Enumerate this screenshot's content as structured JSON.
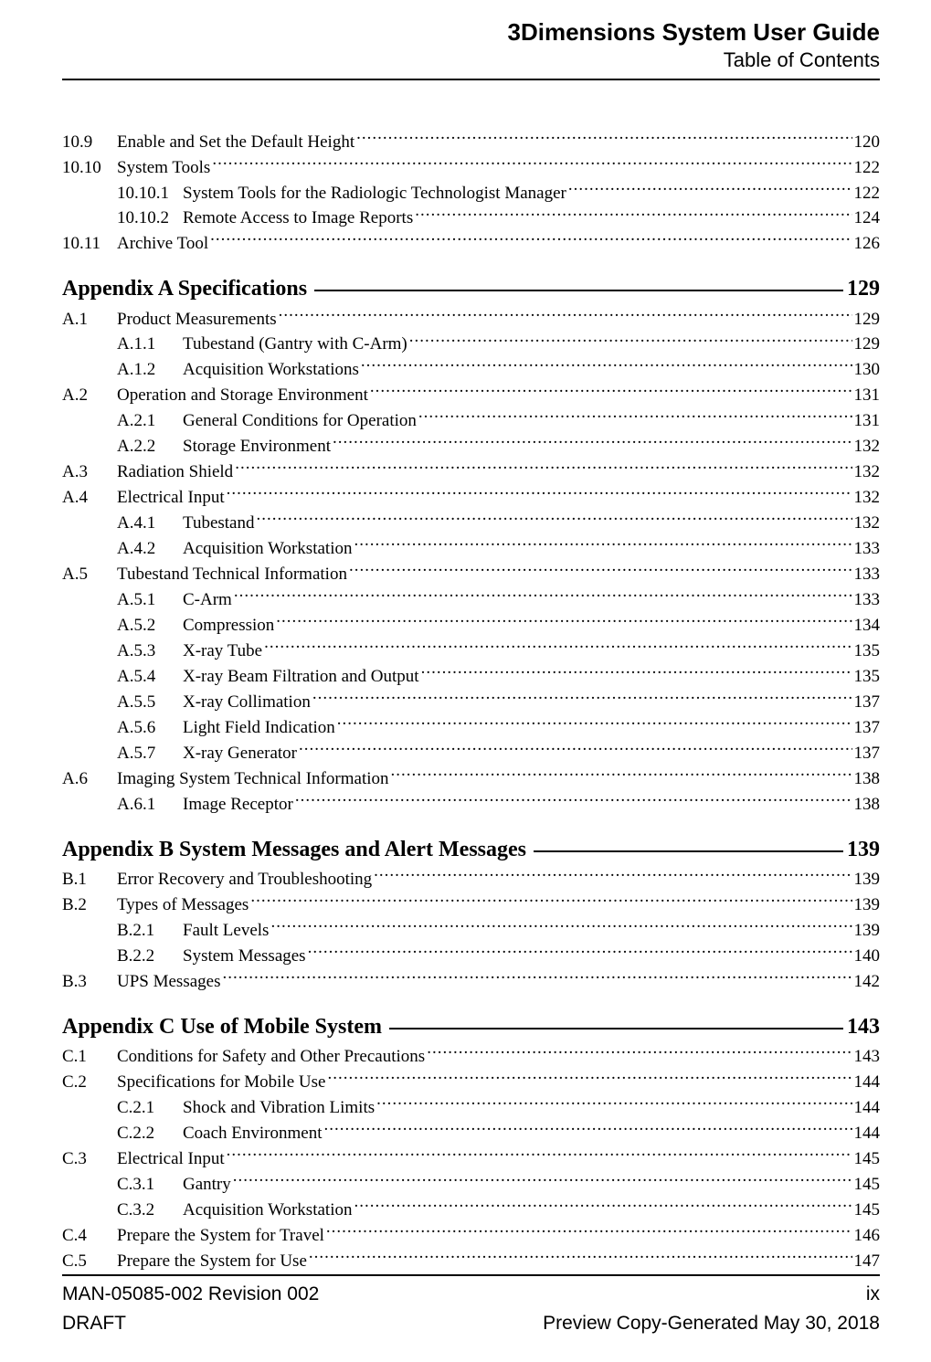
{
  "header": {
    "title": "3Dimensions System User Guide",
    "subtitle": "Table of Contents"
  },
  "sections": [
    {
      "type": "group",
      "entries": [
        {
          "level": 1,
          "num": "10.9",
          "label": "Enable and Set the Default Height",
          "page": "120"
        },
        {
          "level": 1,
          "num": "10.10",
          "label": "System Tools",
          "page": "122"
        },
        {
          "level": 2,
          "num": "10.10.1",
          "label": "System Tools for the Radiologic Technologist Manager",
          "page": "122"
        },
        {
          "level": 2,
          "num": "10.10.2",
          "label": "Remote Access to Image Reports",
          "page": "124"
        },
        {
          "level": 1,
          "num": "10.11",
          "label": "Archive Tool",
          "page": "126"
        }
      ]
    },
    {
      "type": "appendix",
      "title": "Appendix A Specifications",
      "page": "129",
      "entries": [
        {
          "level": 1,
          "num": "A.1",
          "label": "Product Measurements",
          "page": "129"
        },
        {
          "level": 2,
          "num": "A.1.1",
          "label": "Tubestand (Gantry with C-Arm)",
          "page": "129"
        },
        {
          "level": 2,
          "num": "A.1.2",
          "label": "Acquisition Workstations",
          "page": "130"
        },
        {
          "level": 1,
          "num": "A.2",
          "label": "Operation and Storage Environment",
          "page": "131"
        },
        {
          "level": 2,
          "num": "A.2.1",
          "label": "General Conditions for Operation",
          "page": "131"
        },
        {
          "level": 2,
          "num": "A.2.2",
          "label": "Storage Environment",
          "page": "132"
        },
        {
          "level": 1,
          "num": "A.3",
          "label": "Radiation Shield",
          "page": "132"
        },
        {
          "level": 1,
          "num": "A.4",
          "label": "Electrical Input",
          "page": "132"
        },
        {
          "level": 2,
          "num": "A.4.1",
          "label": "Tubestand",
          "page": "132"
        },
        {
          "level": 2,
          "num": "A.4.2",
          "label": "Acquisition Workstation",
          "page": "133"
        },
        {
          "level": 1,
          "num": "A.5",
          "label": "Tubestand Technical Information",
          "page": "133"
        },
        {
          "level": 2,
          "num": "A.5.1",
          "label": "C-Arm",
          "page": "133"
        },
        {
          "level": 2,
          "num": "A.5.2",
          "label": "Compression",
          "page": "134"
        },
        {
          "level": 2,
          "num": "A.5.3",
          "label": "X-ray Tube",
          "page": "135"
        },
        {
          "level": 2,
          "num": "A.5.4",
          "label": "X-ray Beam Filtration and Output",
          "page": "135"
        },
        {
          "level": 2,
          "num": "A.5.5",
          "label": "X-ray Collimation",
          "page": "137"
        },
        {
          "level": 2,
          "num": "A.5.6",
          "label": "Light Field Indication",
          "page": "137"
        },
        {
          "level": 2,
          "num": "A.5.7",
          "label": "X-ray Generator",
          "page": "137"
        },
        {
          "level": 1,
          "num": "A.6",
          "label": "Imaging System Technical Information",
          "page": "138"
        },
        {
          "level": 2,
          "num": "A.6.1",
          "label": "Image Receptor",
          "page": "138"
        }
      ]
    },
    {
      "type": "appendix",
      "title": "Appendix B System Messages and Alert Messages",
      "page": "139",
      "entries": [
        {
          "level": 1,
          "num": "B.1",
          "label": "Error Recovery and Troubleshooting",
          "page": "139"
        },
        {
          "level": 1,
          "num": "B.2",
          "label": "Types of Messages",
          "page": "139"
        },
        {
          "level": 2,
          "num": "B.2.1",
          "label": "Fault Levels",
          "page": "139"
        },
        {
          "level": 2,
          "num": "B.2.2",
          "label": "System Messages",
          "page": "140"
        },
        {
          "level": 1,
          "num": "B.3",
          "label": "UPS Messages",
          "page": "142"
        }
      ]
    },
    {
      "type": "appendix",
      "title": "Appendix C Use of Mobile System",
      "page": "143",
      "entries": [
        {
          "level": 1,
          "num": "C.1",
          "label": "Conditions for Safety and Other Precautions",
          "page": "143"
        },
        {
          "level": 1,
          "num": "C.2",
          "label": "Specifications for Mobile Use",
          "page": "144"
        },
        {
          "level": 2,
          "num": "C.2.1",
          "label": "Shock and Vibration Limits",
          "page": "144"
        },
        {
          "level": 2,
          "num": "C.2.2",
          "label": "Coach Environment",
          "page": "144"
        },
        {
          "level": 1,
          "num": "C.3",
          "label": "Electrical Input",
          "page": "145"
        },
        {
          "level": 2,
          "num": "C.3.1",
          "label": "Gantry",
          "page": "145"
        },
        {
          "level": 2,
          "num": "C.3.2",
          "label": "Acquisition Workstation",
          "page": "145"
        },
        {
          "level": 1,
          "num": "C.4",
          "label": "Prepare the System for Travel",
          "page": "146"
        },
        {
          "level": 1,
          "num": "C.5",
          "label": "Prepare the System for Use",
          "page": "147"
        }
      ]
    }
  ],
  "footer": {
    "left1": "MAN-05085-002 Revision 002",
    "right1": "ix",
    "left2": "DRAFT",
    "right2": "Preview Copy-Generated May 30, 2018"
  }
}
